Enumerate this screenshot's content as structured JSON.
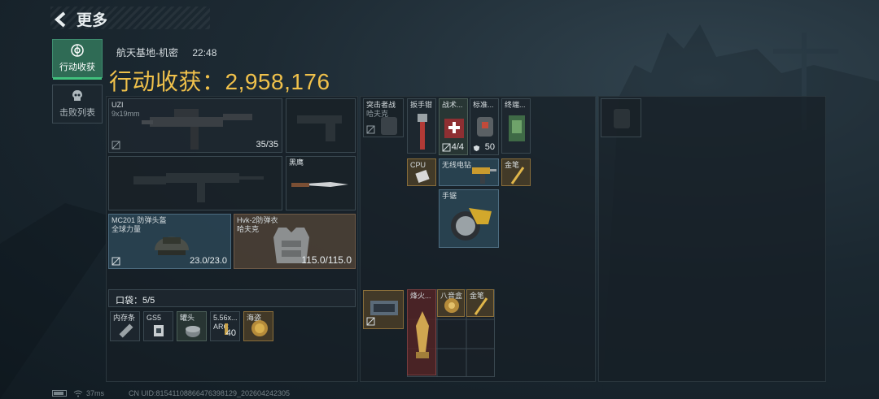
{
  "header": {
    "back_label": "更多"
  },
  "tabs": [
    {
      "label": "行动收获",
      "icon": "target-icon",
      "active": true
    },
    {
      "label": "击败列表",
      "icon": "skull-icon",
      "active": false
    }
  ],
  "raid": {
    "map": "航天基地-机密",
    "time": "22:48"
  },
  "loot": {
    "title": "行动收获：2,958,176"
  },
  "weapons": {
    "primary": {
      "name": "UZI",
      "ammo_type": "9x19mm",
      "ammo": "35/35"
    },
    "melee": {
      "name": "黑鹰"
    }
  },
  "gear": {
    "helmet": {
      "name": "MC201 防弹头盔",
      "maker": "全球力量",
      "durability": "23.0/23.0"
    },
    "armor": {
      "name": "Hvk-2防弹衣",
      "maker": "哈夫克",
      "durability": "115.0/115.0"
    }
  },
  "pocket": {
    "label": "口袋：5/5",
    "items": [
      {
        "name": "内存条"
      },
      {
        "name": "GS5"
      },
      {
        "name": "罐头"
      },
      {
        "name": "5.56x...",
        "sub": "ARC",
        "count": "40"
      },
      {
        "name": "海盗"
      }
    ]
  },
  "backpack": {
    "items": [
      {
        "name": "突击者战",
        "sub": "哈夫克"
      },
      {
        "name": "扳手钳"
      },
      {
        "name": "战术...",
        "count": "4/4"
      },
      {
        "name": "标准...",
        "count": "50"
      },
      {
        "name": "终端..."
      },
      {
        "name": "CPU"
      },
      {
        "name": "无线电钻"
      },
      {
        "name": "金笔"
      },
      {
        "name": "手锯"
      }
    ]
  },
  "safebox": {
    "items": [
      {
        "name": "烽火..."
      },
      {
        "name": "八音盒"
      },
      {
        "name": "金笔"
      }
    ]
  },
  "status": {
    "ping": "37ms",
    "uid": "CN UID:8154110886647639812​9_202604242305"
  },
  "colors": {
    "accent_gold": "#f0c14b",
    "tab_active": "#2f6b55",
    "tab_active_bar": "#41c17d"
  }
}
